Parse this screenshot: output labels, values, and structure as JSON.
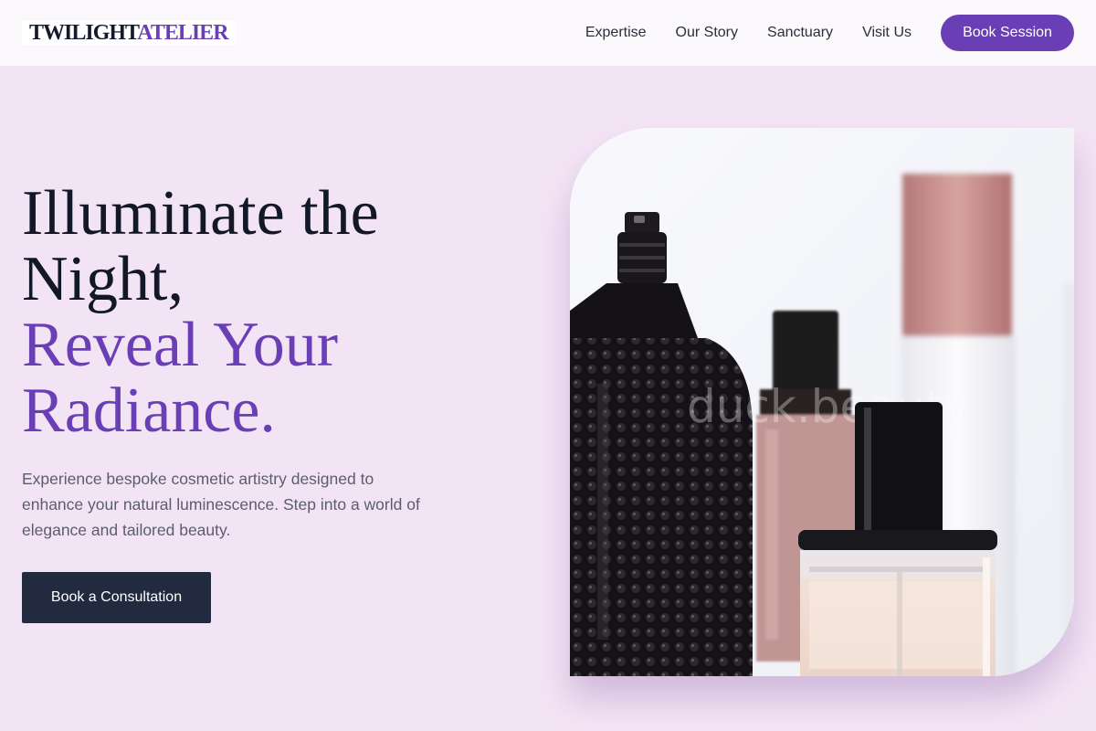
{
  "brand": {
    "part1": "TWILIGHT",
    "part2": "ATELIER"
  },
  "nav": {
    "links": [
      "Expertise",
      "Our Story",
      "Sanctuary",
      "Visit Us"
    ],
    "cta": "Book Session"
  },
  "hero": {
    "title_lines": [
      "Illuminate the",
      "Night,",
      "Reveal Your",
      "Radiance."
    ],
    "description": "Experience bespoke cosmetic artistry designed to enhance your natural luminescence. Step into a world of elegance and tailored beauty.",
    "cta": "Book a Consultation",
    "image_watermark": "duck.beauty"
  },
  "colors": {
    "background": "#f3e4f5",
    "accent": "#6a3fb5",
    "dark_text": "#131828",
    "button_dark": "#212a3f"
  }
}
